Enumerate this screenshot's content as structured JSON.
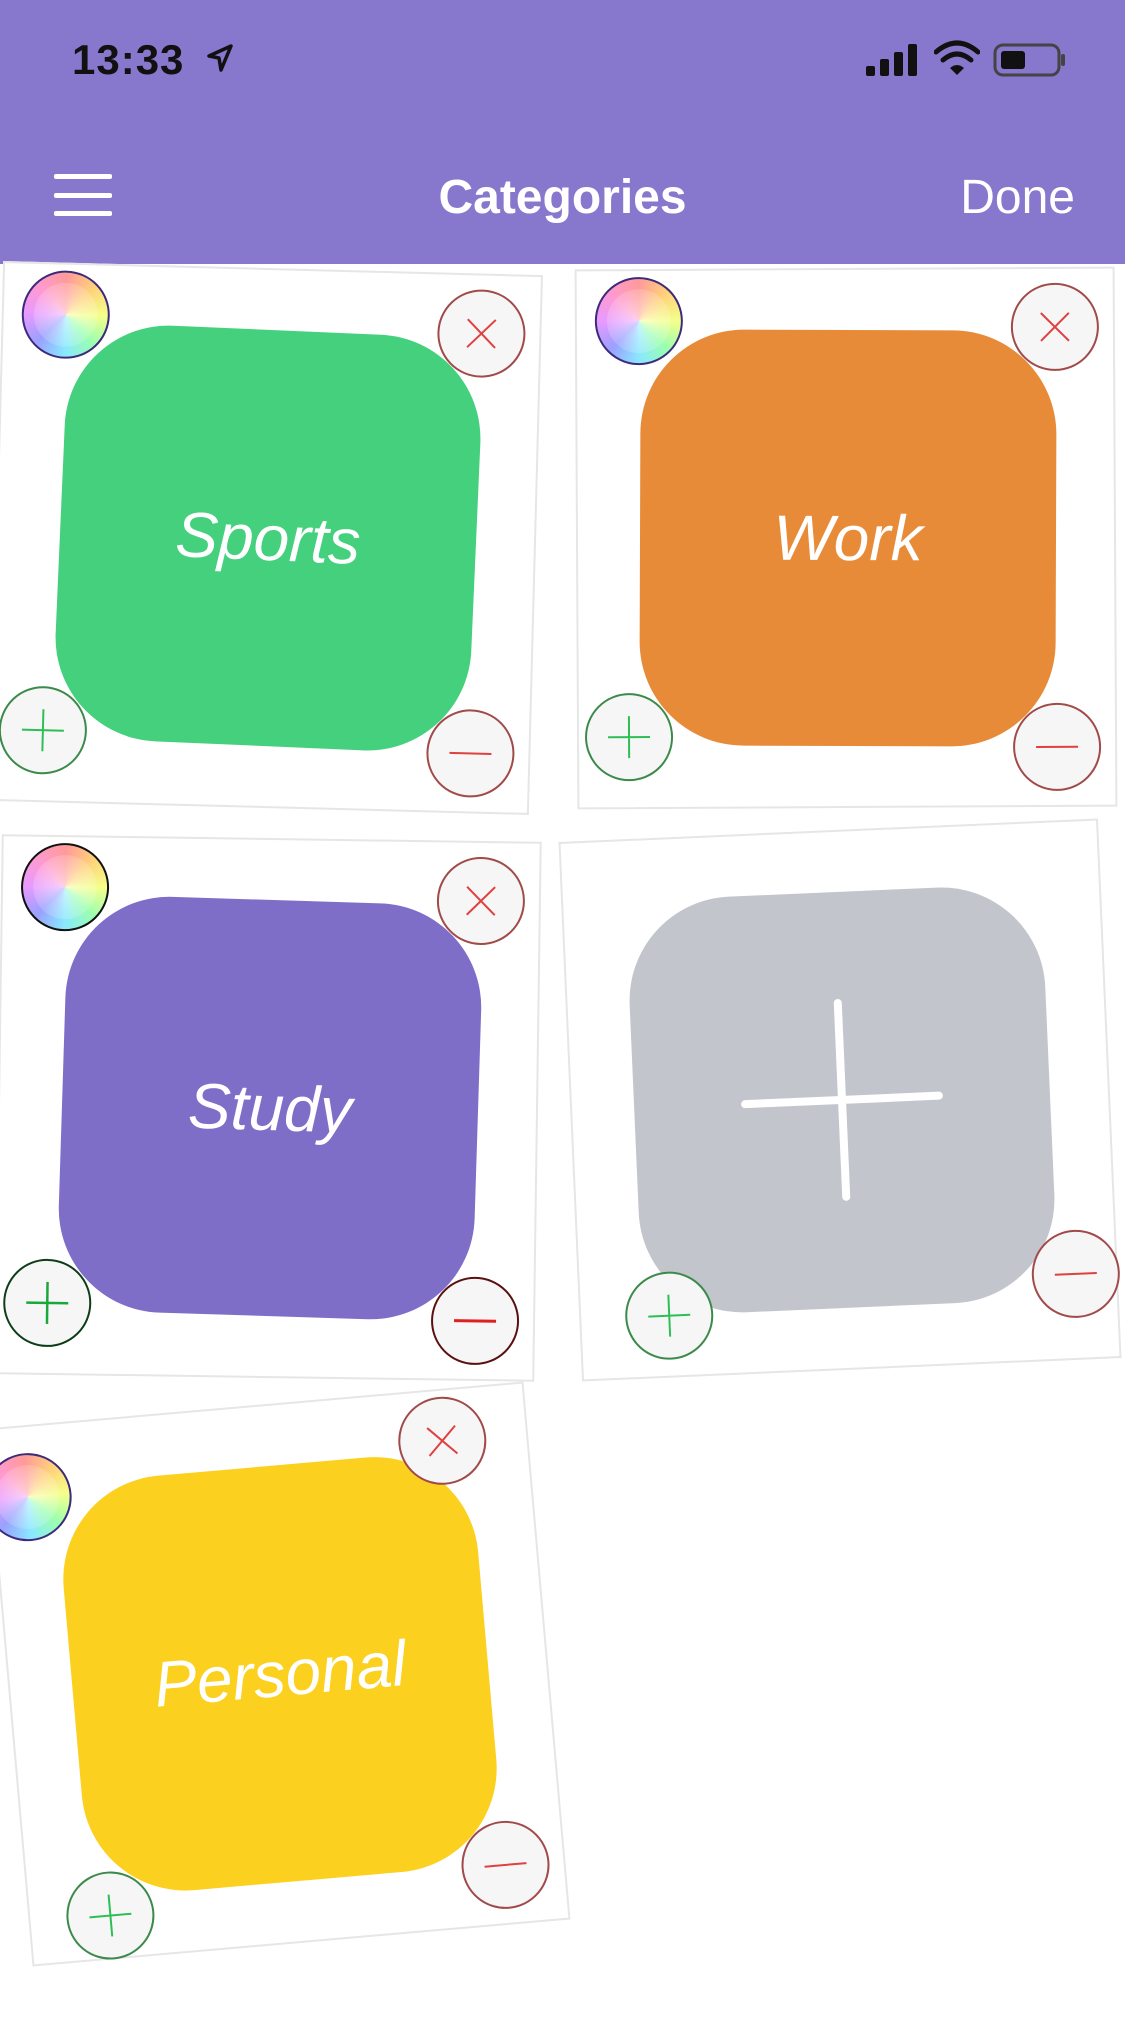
{
  "status_bar": {
    "time": "13:33",
    "location_icon": "location-arrow-icon",
    "signal_icon": "cellular-signal-icon",
    "wifi_icon": "wifi-icon",
    "battery_icon": "battery-icon"
  },
  "nav": {
    "title": "Categories",
    "done_label": "Done",
    "menu_icon": "hamburger-menu-icon"
  },
  "colors": {
    "header": "#8878CD",
    "sports": "#45D07E",
    "work": "#E88B39",
    "study": "#7F6EC8",
    "add": "#C2C5CC",
    "personal": "#FCD01E"
  },
  "categories": [
    {
      "label": "Sports"
    },
    {
      "label": "Work"
    },
    {
      "label": "Study"
    },
    {
      "label": "Personal"
    }
  ],
  "tile_controls": {
    "color_picker_icon": "color-wheel-icon",
    "delete_icon": "close-icon",
    "increase_icon": "plus-icon",
    "decrease_icon": "minus-icon"
  },
  "add_tile": {
    "icon": "plus-icon"
  }
}
